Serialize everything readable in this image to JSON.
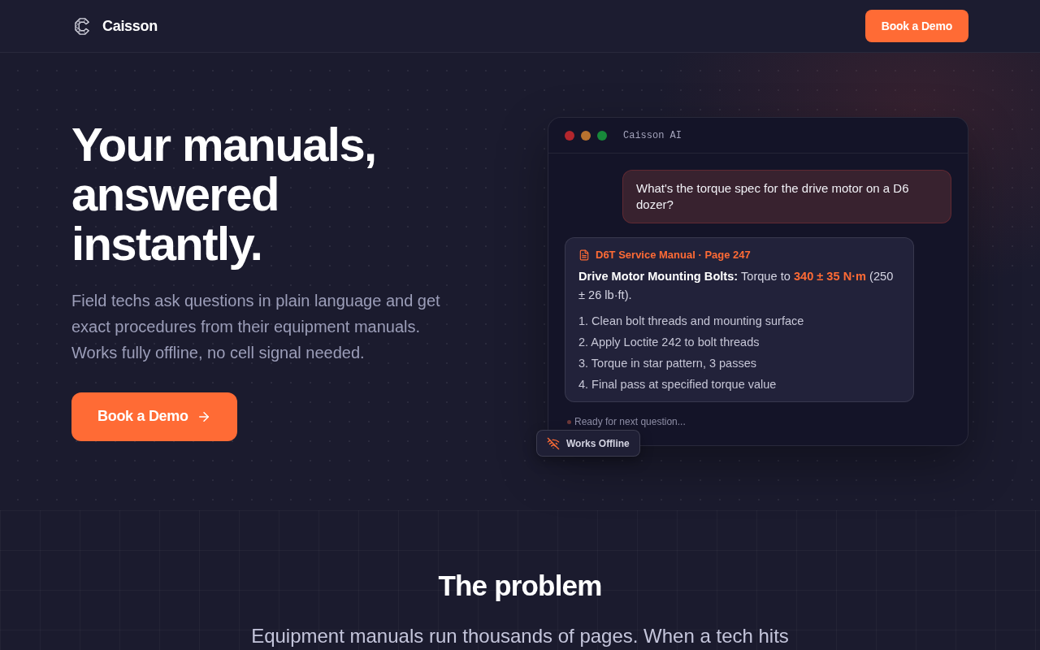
{
  "nav": {
    "brand": "Caisson",
    "cta": "Book a Demo"
  },
  "hero": {
    "heading": "Your manuals, answered instantly.",
    "description": "Field techs ask questions in plain language and get exact procedures from their equipment manuals. Works fully offline, no cell signal needed.",
    "cta": "Book a Demo"
  },
  "chat": {
    "title": "Caisson AI",
    "messages": [
      {
        "kind": "question",
        "text": "What's the torque spec for the drive motor on a D6 dozer?"
      },
      {
        "kind": "answer",
        "source": "D6T Service Manual · Page 247",
        "label": "Drive Motor Mounting Bolts:",
        "text": "Torque to",
        "value": "340 ± 35 N·m",
        "note": "(250 ± 26 lb·ft).",
        "steps": [
          "1. Clean bolt threads and mounting surface",
          "2. Apply Loctite 242 to bolt threads",
          "3. Torque in star pattern, 3 passes",
          "4. Final pass at specified torque value"
        ]
      }
    ],
    "status": "Ready for next question...",
    "badge": "Works Offline"
  },
  "problem": {
    "heading": "The problem",
    "text": "Equipment manuals run thousands of pages. When a tech hits"
  }
}
